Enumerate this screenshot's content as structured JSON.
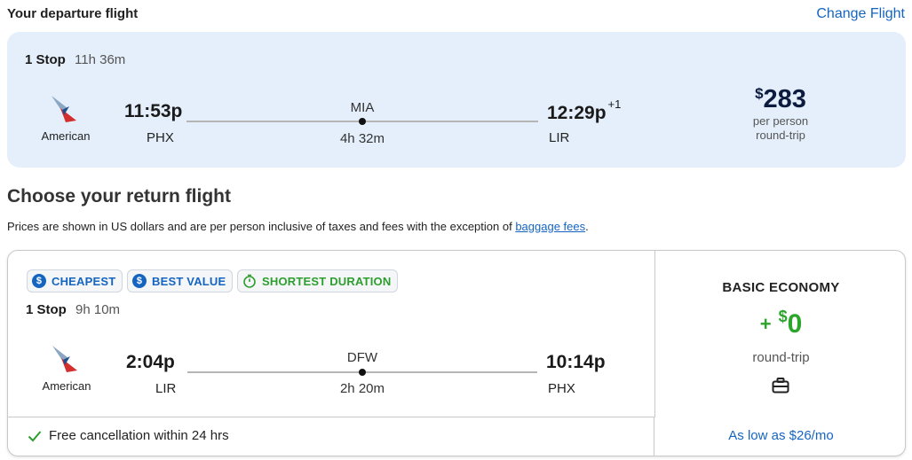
{
  "departure": {
    "header": "Your departure flight",
    "change_label": "Change Flight",
    "stops": "1 Stop",
    "duration": "11h 36m",
    "airline": "American",
    "depart_time": "11:53p",
    "depart_code": "PHX",
    "layover_code": "MIA",
    "layover_duration": "4h 32m",
    "arrive_time": "12:29p",
    "arrive_offset": "+1",
    "arrive_code": "LIR",
    "price_currency": "$",
    "price_amount": "283",
    "price_sub1": "per person",
    "price_sub2": "round-trip"
  },
  "return": {
    "title": "Choose your return flight",
    "disclaimer": "Prices are shown in US dollars and are per person inclusive of taxes and fees with the exception of",
    "disclaimer_link": "baggage fees",
    "disclaimer_end": ".",
    "badges": [
      "CHEAPEST",
      "BEST VALUE",
      "SHORTEST DURATION"
    ],
    "stops": "1 Stop",
    "duration": "9h 10m",
    "airline": "American",
    "depart_time": "2:04p",
    "depart_code": "LIR",
    "layover_code": "DFW",
    "layover_duration": "2h 20m",
    "arrive_time": "10:14p",
    "arrive_code": "PHX",
    "free_cancel": "Free cancellation within 24 hrs",
    "fare_type": "BASIC ECONOMY",
    "fare_plus": "+",
    "fare_currency": "$",
    "fare_amount": "0",
    "fare_sub": "round-trip",
    "low_price": "As low as $26/mo"
  },
  "colors": {
    "accent_blue": "#1565c0",
    "card_bg": "#e4effb",
    "green": "#2ba52b"
  },
  "icons": [
    "american-airlines-logo-icon",
    "dollar-circle-icon",
    "stopwatch-icon",
    "checkmark-icon",
    "briefcase-icon"
  ]
}
